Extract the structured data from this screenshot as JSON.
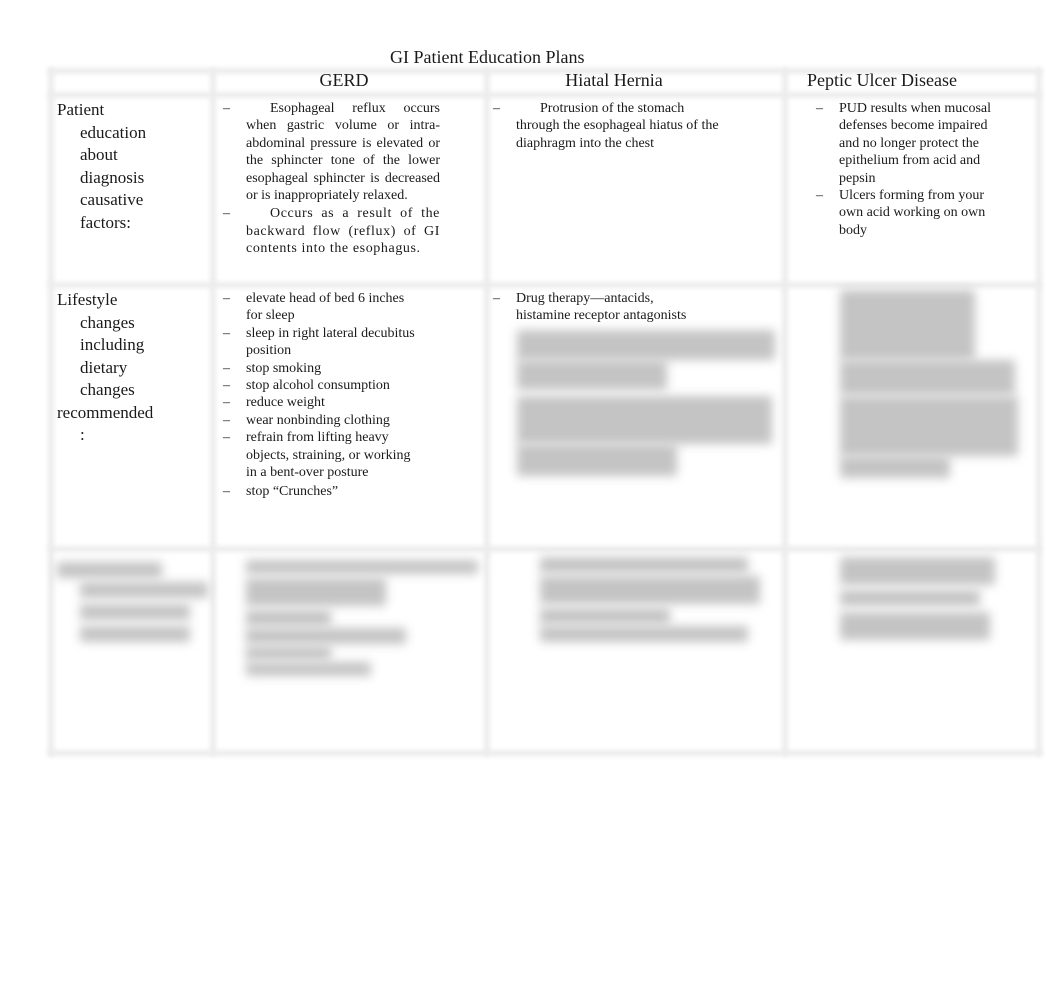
{
  "document": {
    "title": "GI Patient Education Plans"
  },
  "table": {
    "columns": [
      "GERD",
      "Hiatal Hernia",
      "Peptic Ulcer Disease"
    ],
    "rows": [
      {
        "label_lines": [
          "Patient",
          "education",
          "about",
          "diagnosis",
          "causative",
          "factors:"
        ],
        "gerd": [
          "Esophageal reflux occurs when gastric volume or intra-abdominal pressure is elevated or the sphincter tone of the lower esophageal sphincter is decreased or is inappropriately relaxed.",
          "Occurs as a result of the backward flow (reflux) of GI contents into the esophagus."
        ],
        "hiatal_hernia": [
          "Protrusion of the stomach through the esophageal hiatus of the diaphragm into the chest"
        ],
        "pud": [
          "PUD results when mucosal defenses become impaired and no longer protect the epithelium from acid and pepsin",
          "Ulcers forming from your own acid working on own body"
        ]
      },
      {
        "label_lines": [
          "Lifestyle",
          "changes",
          "including",
          "dietary",
          "changes",
          "recommended",
          ":"
        ],
        "gerd": [
          "elevate head of bed 6 inches for sleep",
          "sleep in right lateral decubitus position",
          "stop smoking",
          "stop alcohol consumption",
          "reduce weight",
          "wear nonbinding clothing",
          "refrain from lifting heavy objects, straining, or working in a bent-over posture",
          "stop “Crunches”"
        ],
        "hiatal_hernia": [
          "Drug therapy—antacids, histamine receptor antagonists"
        ],
        "hiatal_hernia_obscured": true,
        "pud_obscured": true
      },
      {
        "obscured": true
      }
    ],
    "bullet_glyph": "–"
  }
}
